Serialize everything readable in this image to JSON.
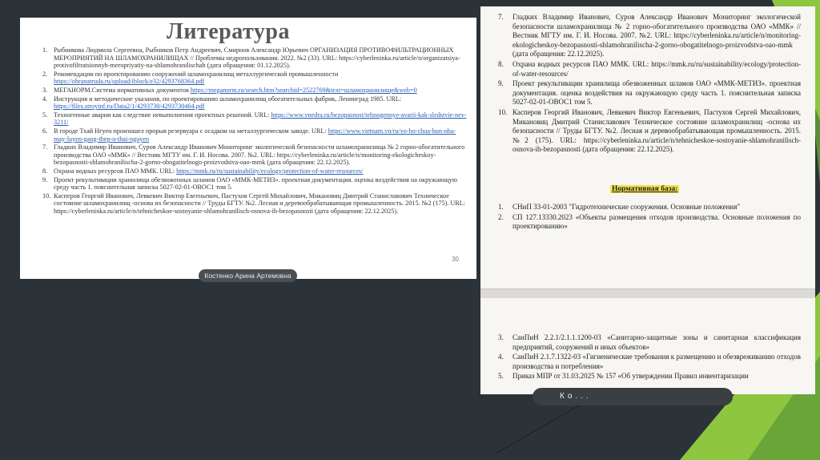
{
  "left_slide": {
    "title": "Литература",
    "page_number": "30",
    "references": [
      {
        "num": "1.",
        "text": "Рыбникова Людмила Сергеевна, Рыбников Петр Андреевич, Смирнов Александр Юрьевич ОРГАНИЗАЦИЯ ПРОТИВОФИЛЬТРАЦИОННЫХ МЕРОПРИЯТИЙ НА ШЛАМОХРАНИЛИЩАХ // Проблемы недропользования. 2022. №2 (33). URL: https://cyberleninka.ru/article/n/organizatsiya-protivofiltratsionnyh-meropriyatiy-na-shlamohranilischah (дата обращения: 01.12.2025).",
        "link": ""
      },
      {
        "num": "2.",
        "text": "Рекомендации по проектированию сооружений шламохранилищ металлургической промышленности",
        "link": "https://ohranatruda.ru/upload/iblock/e32/4293768364.pdf"
      },
      {
        "num": "3.",
        "text": "МЕГАНОРМ.Система нормативных документов",
        "link": "https://meganorm.ru/search.htm?searchid=2522769&text=шламохранилище&web=0"
      },
      {
        "num": "4.",
        "text": "Инструкция и методические указания, по проектированию шламохранилищ обогатительных фабрик, Ленинград 1985. URL:",
        "link": "https://files.stroyinf.ru/Data2/1/4293730/4293730464.pdf"
      },
      {
        "num": "5.",
        "text": "Техногенные аварии как следствие невыполнения проектных решений. URL:",
        "link": "https://www.vnedra.ru/bezopasnost/tehnogennye-avarii-kak-sledstvie-nev-3211/"
      },
      {
        "num": "6.",
        "text": "В городе Тхай Нгуен произошел прорыв резервуара с осадком на металлургическом заводе. URL:",
        "link": "https://www.vietnam.vn/ru/vo-ho-chua-bun-nha-may-luyen-gang-thep-o-thai-nguyen"
      },
      {
        "num": "7.",
        "text": "Гладких Владимир Иванович, Суров Александр Иванович Мониторинг экологической безопасности шламохранилища № 2 горно-обогатительного производства ОАО «ММК» // Вестник МГТУ им. Г. И. Носова. 2007. №2. URL: https://cyberleninka.ru/article/n/monitoring-ekologicheskoy-bezopasnosti-shlamohranilischa-2-gorno-obogatitelnogo-proizvodstva-oao-mmk (дата обращения: 22.12.2025).",
        "link": ""
      },
      {
        "num": "8.",
        "text": "Охрана водных ресурсов ПАО ММК. URL:",
        "link": "https://mmk.ru/ru/sustainability/ecology/protection-of-water-resources/"
      },
      {
        "num": "9.",
        "text": "Проект рекультивации хранилища обезвоженных шламов ОАО «ММК-МЕТИЗ». проектная документация. оценка воздействия на окружающую среду часть 1. пояснительная записка 5027-02-01-ОВОС1 том 5.",
        "link": ""
      },
      {
        "num": "10.",
        "text": "Касперов Георгий Иванович, Левкевич Виктор Евгеньевич, Пастухов Сергей Михайлович, Микановиц Дмитрий Станиславович Техническое состояние шламохранилищ -основа их безопасности // Труды БГТУ. №2. Лесная и деревообрабатывающая промышленность. 2015. №2 (175). URL: https://cyberleninka.ru/article/n/tehnicheskoe-sostoyanie-shlamohranilisch-osnova-ih-bezopasnosti (дата обращения: 22.12.2025).",
        "link": ""
      }
    ]
  },
  "name_tag": "Костенко Арина Артемовна",
  "right_doc": {
    "references": [
      {
        "num": "7.",
        "text": "Гладких Владимир Иванович, Суров Александр Иванович Мониторинг экологической безопасности шламохранилища № 2 горно-обогатительного производства ОАО «ММК» // Вестник МГТУ им. Г. И. Носова. 2007. №2. URL: https://cyberleninka.ru/article/n/monitoring-ekologicheskoy-bezopasnosti-shlamohranilischa-2-gorno-obogatitelnogo-proizvodstva-oao-mmk (дата обращения: 22.12.2025)."
      },
      {
        "num": "8.",
        "text": "Охрана водных ресурсов ПАО ММК. URL: https://mmk.ru/ru/sustainability/ecology/protection-of-water-resources/"
      },
      {
        "num": "9.",
        "text": "Проект рекультивации хранилища обезвоженных шламов ОАО «ММК-МЕТИЗ». проектная документация. оценка воздействия на окружающую среду часть 1. пояснительная записка 5027-02-01-ОВОС1 том 5."
      },
      {
        "num": "10.",
        "text": "Касперов Георгий Иванович, Левкевич Виктор Евгеньевич, Пастухов Сергей Михайлович, Микановиц Дмитрий Станиславович Техническое состояние шламохранилищ -основа их безопасности // Труды БГТУ. №2. Лесная и деревообрабатывающая промышленность. 2015. №2 (175). URL: https://cyberleninka.ru/article/n/tehnicheskoe-sostoyanie-shlamohranilisch-osnova-ih-bezopasnosti (дата обращения: 22.12.2025)."
      }
    ],
    "norm_heading": "Нормативная база:",
    "norms": [
      {
        "num": "1.",
        "text": "СНиП 33-01-2003 \"Гидротехнические сооружения. Основные положения\""
      },
      {
        "num": "2.",
        "text": "СП 127.13330.2023 «Объекты размещения отходов производства. Основные положения по проектированию»"
      }
    ],
    "norms_page2": [
      {
        "num": "3.",
        "text": "СанПиН 2.2.1/2.1.1.1200-03 «Санитарно-защитные зоны и санитарная классификация предприятий, сооружений и иных объектов»"
      },
      {
        "num": "4.",
        "text": "СанПиН 2.1.7.1322-03 «Гигиенические требования к размещению и обезвреживанию отходов производства и потребления»"
      },
      {
        "num": "5.",
        "text": "Приказ МПР от 31.03.2025 № 157 «Об утверждении Правил инвентаризации"
      }
    ]
  },
  "dark_tag": "Ко..."
}
